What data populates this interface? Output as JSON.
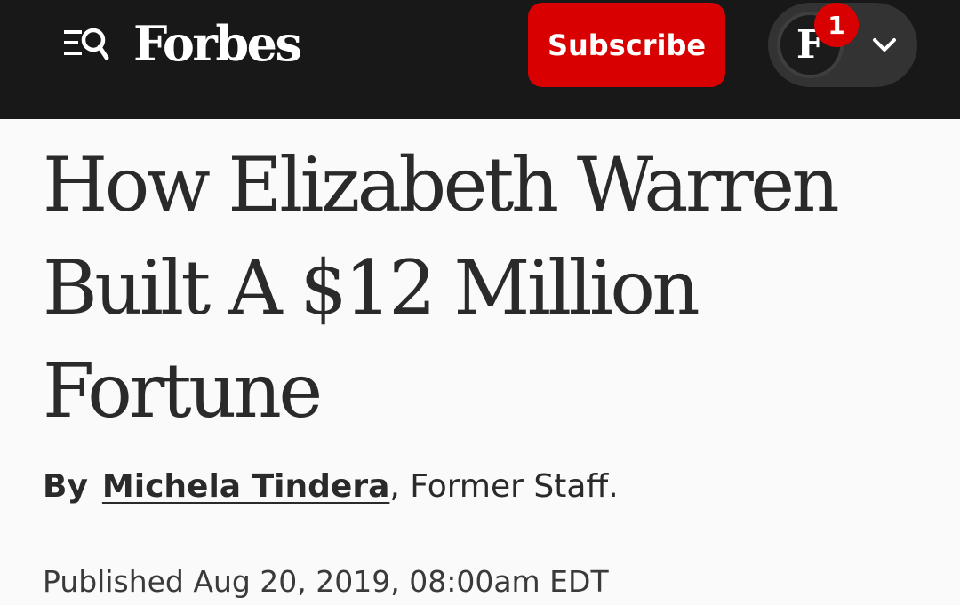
{
  "header": {
    "menu_icon": "menu-search-icon",
    "logo_text": "Forbes",
    "subscribe_label": "Subscribe",
    "account": {
      "avatar_letter": "F",
      "notification_count": "1",
      "dropdown_icon": "chevron-down-icon"
    }
  },
  "article": {
    "title": "How Elizabeth Warren Built A $12 Million Fortune",
    "byline": {
      "prefix": "By",
      "author": "Michela Tindera",
      "separator": ",",
      "role": " Former Staff."
    },
    "published": "Published Aug 20, 2019, 08:00am EDT"
  },
  "colors": {
    "header_bg": "#181818",
    "subscribe_bg": "#d80000",
    "badge_bg": "#d80000",
    "page_bg": "#fafafa",
    "text": "#2a2a2a"
  }
}
